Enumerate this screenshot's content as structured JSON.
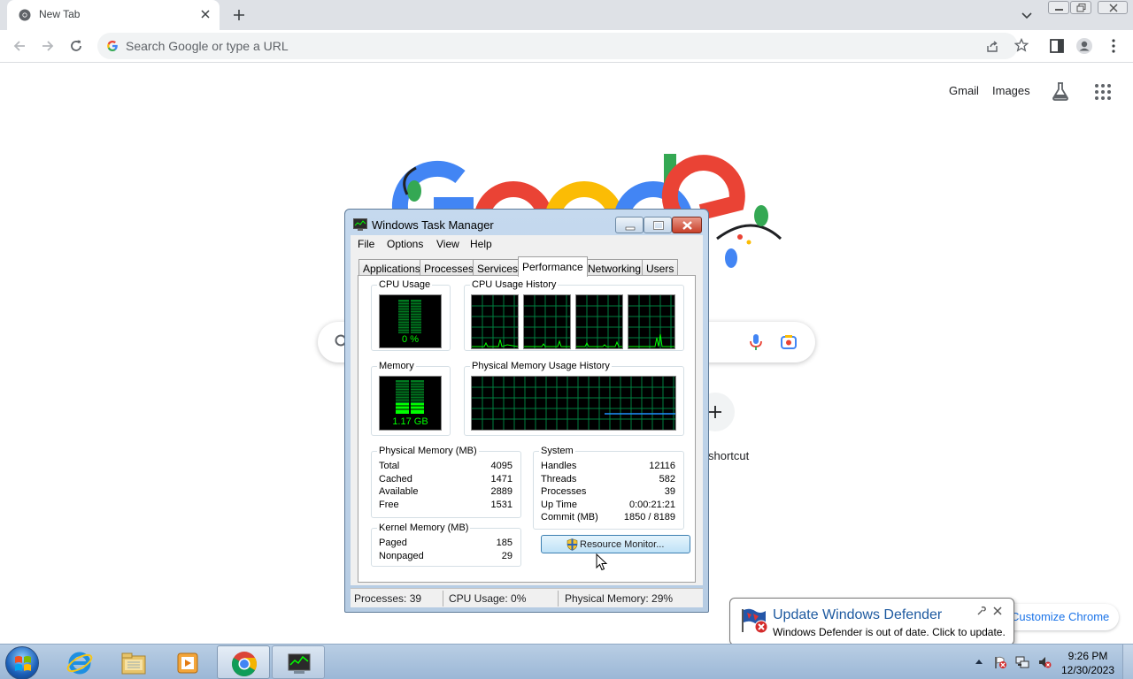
{
  "browser": {
    "tab_title": "New Tab",
    "omnibox_placeholder": "Search Google or type a URL"
  },
  "ntp": {
    "gmail": "Gmail",
    "images": "Images",
    "add_shortcut_label": "shortcut",
    "customize_label": "Customize Chrome"
  },
  "task_manager": {
    "title": "Windows Task Manager",
    "menu": [
      "File",
      "Options",
      "View",
      "Help"
    ],
    "tabs": [
      "Applications",
      "Processes",
      "Services",
      "Performance",
      "Networking",
      "Users"
    ],
    "active_tab": "Performance",
    "cpu_usage_label": "CPU Usage",
    "cpu_usage_value": "0 %",
    "cpu_history_label": "CPU Usage History",
    "memory_label": "Memory",
    "memory_value": "1.17 GB",
    "mem_history_label": "Physical Memory Usage History",
    "physical_memory": {
      "label": "Physical Memory (MB)",
      "rows": [
        [
          "Total",
          "4095"
        ],
        [
          "Cached",
          "1471"
        ],
        [
          "Available",
          "2889"
        ],
        [
          "Free",
          "1531"
        ]
      ]
    },
    "kernel_memory": {
      "label": "Kernel Memory (MB)",
      "rows": [
        [
          "Paged",
          "185"
        ],
        [
          "Nonpaged",
          "29"
        ]
      ]
    },
    "system": {
      "label": "System",
      "rows": [
        [
          "Handles",
          "12116"
        ],
        [
          "Threads",
          "582"
        ],
        [
          "Processes",
          "39"
        ],
        [
          "Up Time",
          "0:00:21:21"
        ],
        [
          "Commit (MB)",
          "1850 / 8189"
        ]
      ]
    },
    "resource_monitor_button": "Resource Monitor...",
    "status": {
      "processes": "Processes: 39",
      "cpu": "CPU Usage: 0%",
      "memory": "Physical Memory: 29%"
    }
  },
  "balloon": {
    "title": "Update Windows Defender",
    "text": "Windows Defender is out of date. Click to update."
  },
  "taskbar": {
    "time": "9:26 PM",
    "date": "12/30/2023"
  },
  "colors": {
    "scope_green": "#00ff00",
    "grid_green": "#008040",
    "mem_line_blue": "#1e90ff",
    "link_blue": "#1a73e8"
  }
}
